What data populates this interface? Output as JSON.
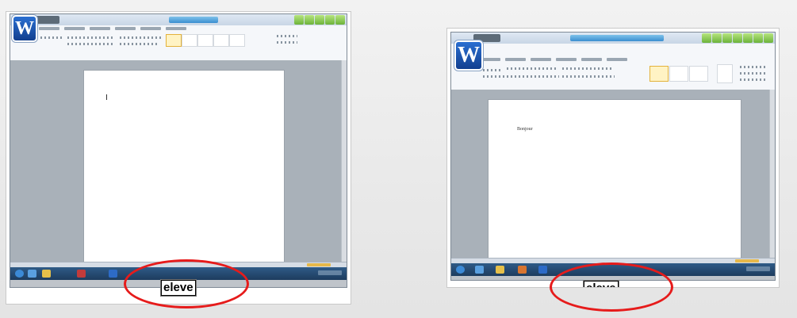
{
  "screenshots": [
    {
      "app_logo_letter": "W",
      "document_text": "",
      "annotation_label": "eleve"
    },
    {
      "app_logo_letter": "W",
      "document_text": "Bonjour",
      "annotation_label": "eleve"
    }
  ],
  "colors": {
    "highlight_ellipse": "#e61b1b",
    "word_blue": "#2a6fd1",
    "taskbar": "#1d3c5e"
  },
  "icons": [
    "word-logo-icon",
    "start-orb-icon",
    "window-minimize-icon",
    "window-maximize-icon",
    "window-close-icon"
  ]
}
